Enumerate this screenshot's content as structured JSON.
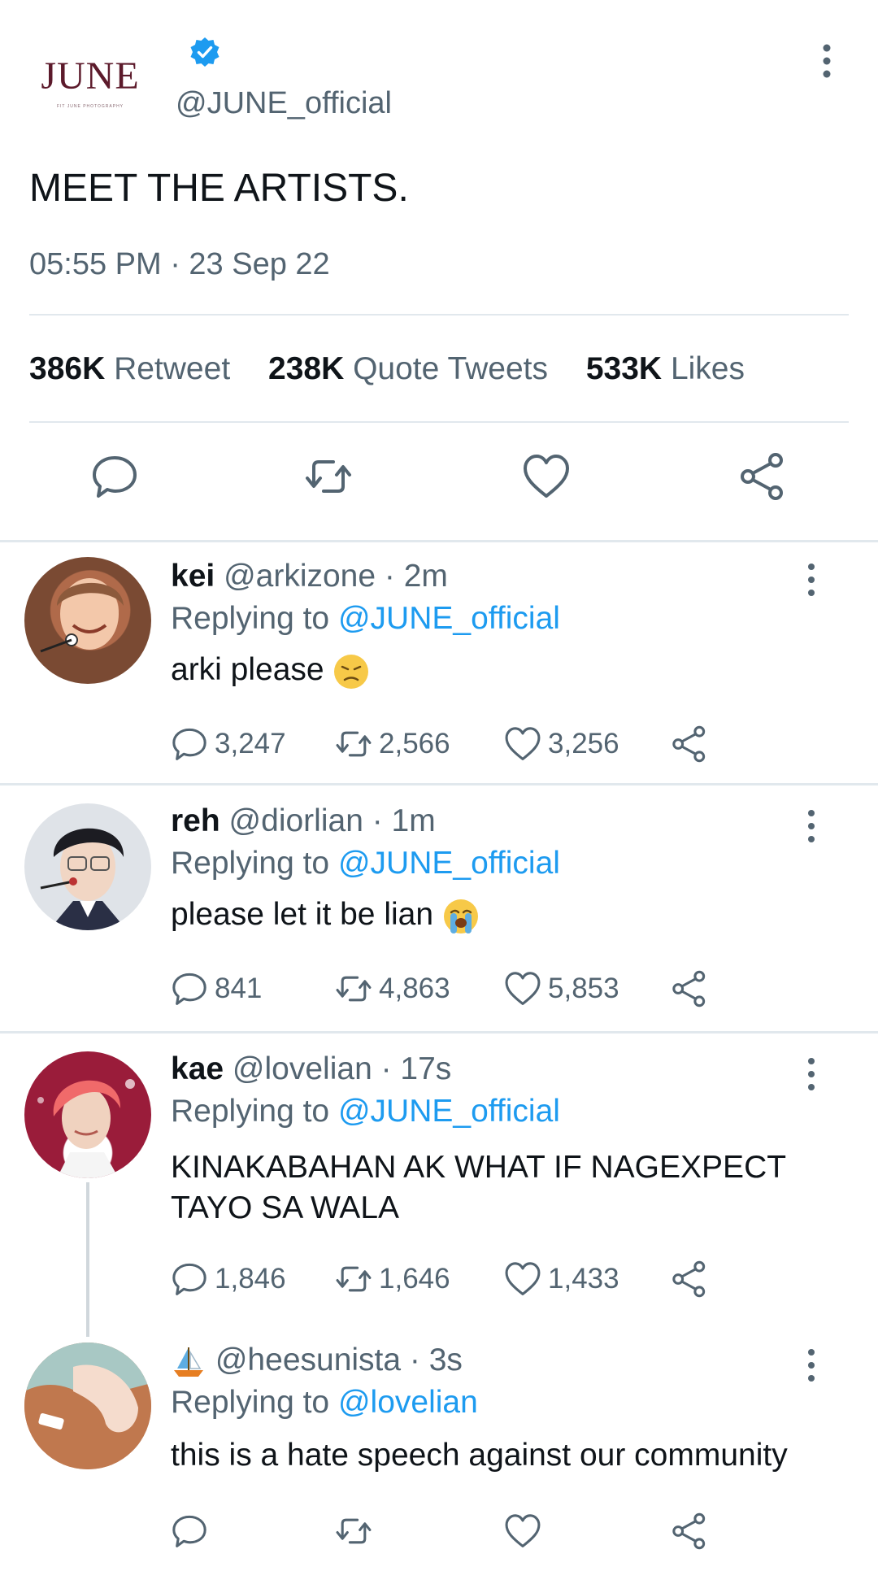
{
  "main_tweet": {
    "logo_text": "JUNE",
    "logo_subtext": "FIT JUNE PHOTOGRAPHY",
    "handle": "@JUNE_official",
    "text": "MEET THE ARTISTS.",
    "timestamp": "05:55 PM · 23 Sep 22",
    "stats": {
      "retweet_count": "386K",
      "retweet_label": "Retweet",
      "quote_count": "238K",
      "quote_label": "Quote Tweets",
      "likes_count": "533K",
      "likes_label": "Likes"
    },
    "colors": {
      "verified": "#1d9bf0",
      "logo": "#5c1a2b"
    }
  },
  "replies": [
    {
      "name": "kei",
      "handle": "@arkizone",
      "time": "· 2m",
      "replying_label": "Replying to",
      "replying_to": "@JUNE_official",
      "text": "arki please",
      "emoji": "disappointed-face",
      "comments": "3,247",
      "retweets": "2,566",
      "likes": "3,256"
    },
    {
      "name": "reh",
      "handle": "@diorlian",
      "time": "· 1m",
      "replying_label": "Replying to",
      "replying_to": "@JUNE_official",
      "text": "please let it be lian",
      "emoji": "loudly-crying-face",
      "comments": "841",
      "retweets": "4,863",
      "likes": "5,853"
    },
    {
      "name": "kae",
      "handle": "@lovelian",
      "time": "· 17s",
      "replying_label": "Replying to",
      "replying_to": "@JUNE_official",
      "text_line1": "KINAKABAHAN AK WHAT IF NAGEXPECT",
      "text_line2": "TAYO SA WALA",
      "comments": "1,846",
      "retweets": "1,646",
      "likes": "1,433"
    },
    {
      "name_emoji": "sailboat",
      "handle": "@heesunista",
      "time": "· 3s",
      "replying_label": "Replying to",
      "replying_to": "@lovelian",
      "text": "this is a hate speech against our community"
    }
  ]
}
